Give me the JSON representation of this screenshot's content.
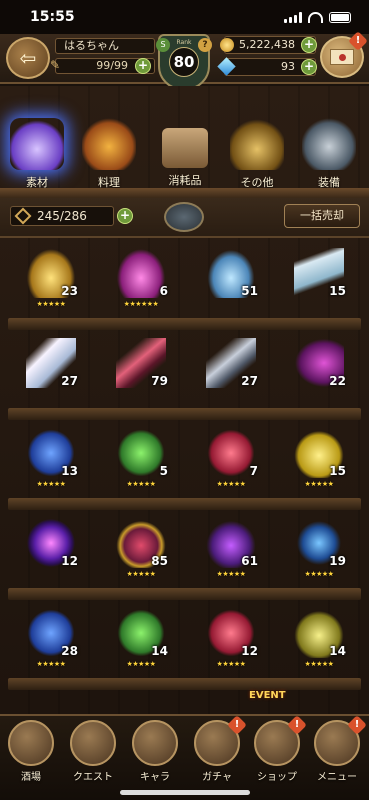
{
  "status": {
    "time": "15:55"
  },
  "header": {
    "player_name": "はるちゃん",
    "stamina": "99/99",
    "rank_label": "Rank",
    "rank_value": "80",
    "gold": "5,222,438",
    "gems": "93"
  },
  "categories": [
    {
      "label": "素材",
      "active": true
    },
    {
      "label": "料理",
      "active": false
    },
    {
      "label": "消耗品",
      "active": false
    },
    {
      "label": "その他",
      "active": false
    },
    {
      "label": "装備",
      "active": false
    }
  ],
  "inventory": {
    "count": "245/286",
    "sell_all_label": "一括売却"
  },
  "items": [
    {
      "icon": "gold-urn",
      "qty": "23",
      "stars": 5
    },
    {
      "icon": "pink-urn",
      "qty": "6",
      "stars": 6
    },
    {
      "icon": "blue-flask",
      "qty": "51",
      "stars": 0
    },
    {
      "icon": "scroll",
      "qty": "15",
      "stars": 0
    },
    {
      "icon": "crystal",
      "qty": "27",
      "stars": 0
    },
    {
      "icon": "red-feather",
      "qty": "79",
      "stars": 0
    },
    {
      "icon": "grey-feather",
      "qty": "27",
      "stars": 0
    },
    {
      "icon": "purple-horn",
      "qty": "22",
      "stars": 0
    },
    {
      "icon": "blue-book",
      "qty": "13",
      "stars": 5
    },
    {
      "icon": "green-book",
      "qty": "5",
      "stars": 5
    },
    {
      "icon": "red-book",
      "qty": "7",
      "stars": 5
    },
    {
      "icon": "gold-potion",
      "qty": "15",
      "stars": 5
    },
    {
      "icon": "purple-orb",
      "qty": "12",
      "stars": 0
    },
    {
      "icon": "gold-dragon",
      "qty": "85",
      "stars": 5
    },
    {
      "icon": "purple-dragon",
      "qty": "61",
      "stars": 5
    },
    {
      "icon": "blue-key",
      "qty": "19",
      "stars": 5
    },
    {
      "icon": "blue-book",
      "qty": "28",
      "stars": 5
    },
    {
      "icon": "green-book",
      "qty": "14",
      "stars": 5
    },
    {
      "icon": "red-book",
      "qty": "12",
      "stars": 5
    },
    {
      "icon": "yellow-bottle",
      "qty": "14",
      "stars": 5
    }
  ],
  "nav": [
    {
      "label": "酒場",
      "badge": false
    },
    {
      "label": "クエスト",
      "badge": false
    },
    {
      "label": "キャラ",
      "badge": false
    },
    {
      "label": "ガチャ",
      "badge": true
    },
    {
      "label": "ショップ",
      "badge": true
    },
    {
      "label": "メニュー",
      "badge": true
    }
  ],
  "event_label": "EVENT"
}
